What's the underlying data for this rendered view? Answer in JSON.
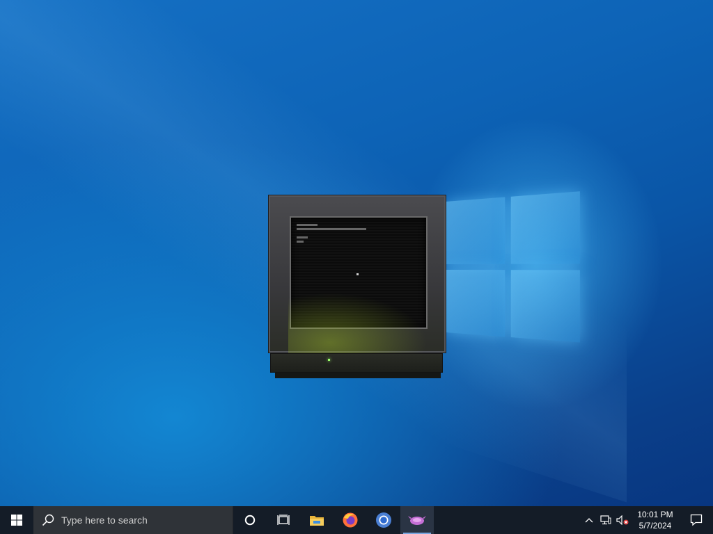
{
  "desktop": {
    "wallpaper": "windows-10-hero",
    "accent_color": "#0a5aa8"
  },
  "window": {
    "kind": "crt-monitor-app",
    "icon": "crt-monitor-icon"
  },
  "taskbar": {
    "start_icon": "windows-start-icon",
    "search": {
      "placeholder": "Type here to search",
      "value": ""
    },
    "apps": [
      {
        "name": "cortana",
        "icon": "cortana-circle-icon",
        "active": false
      },
      {
        "name": "task-view",
        "icon": "task-view-icon",
        "active": false
      },
      {
        "name": "file-explorer",
        "icon": "folder-icon",
        "active": false
      },
      {
        "name": "firefox",
        "icon": "firefox-icon",
        "active": false
      },
      {
        "name": "chromium",
        "icon": "chromium-icon",
        "active": false
      },
      {
        "name": "running-app",
        "icon": "purple-creature-icon",
        "active": true
      }
    ],
    "tray": {
      "icons": [
        "chevron-up-icon",
        "network-icon",
        "volume-muted-icon"
      ],
      "time": "10:01 PM",
      "date": "5/7/2024",
      "notification_icon": "notification-icon"
    }
  }
}
